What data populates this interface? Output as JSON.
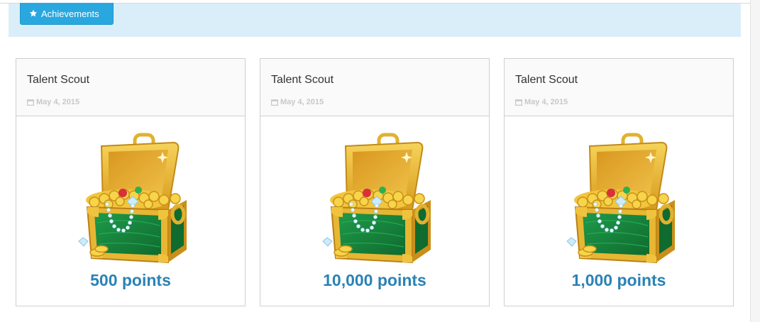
{
  "header": {
    "achievements_label": "Achievements",
    "icon": "star-icon",
    "button_color": "#29a8e0",
    "banner_color": "#d9eef9"
  },
  "cards": [
    {
      "title": "Talent Scout",
      "date": "May 4, 2015",
      "points": "500 points",
      "image": "treasure-chest"
    },
    {
      "title": "Talent Scout",
      "date": "May 4, 2015",
      "points": "10,000 points",
      "image": "treasure-chest"
    },
    {
      "title": "Talent Scout",
      "date": "May 4, 2015",
      "points": "1,000 points",
      "image": "treasure-chest"
    }
  ],
  "colors": {
    "points_text": "#2a82b5",
    "date_text": "#c8c8c8"
  }
}
